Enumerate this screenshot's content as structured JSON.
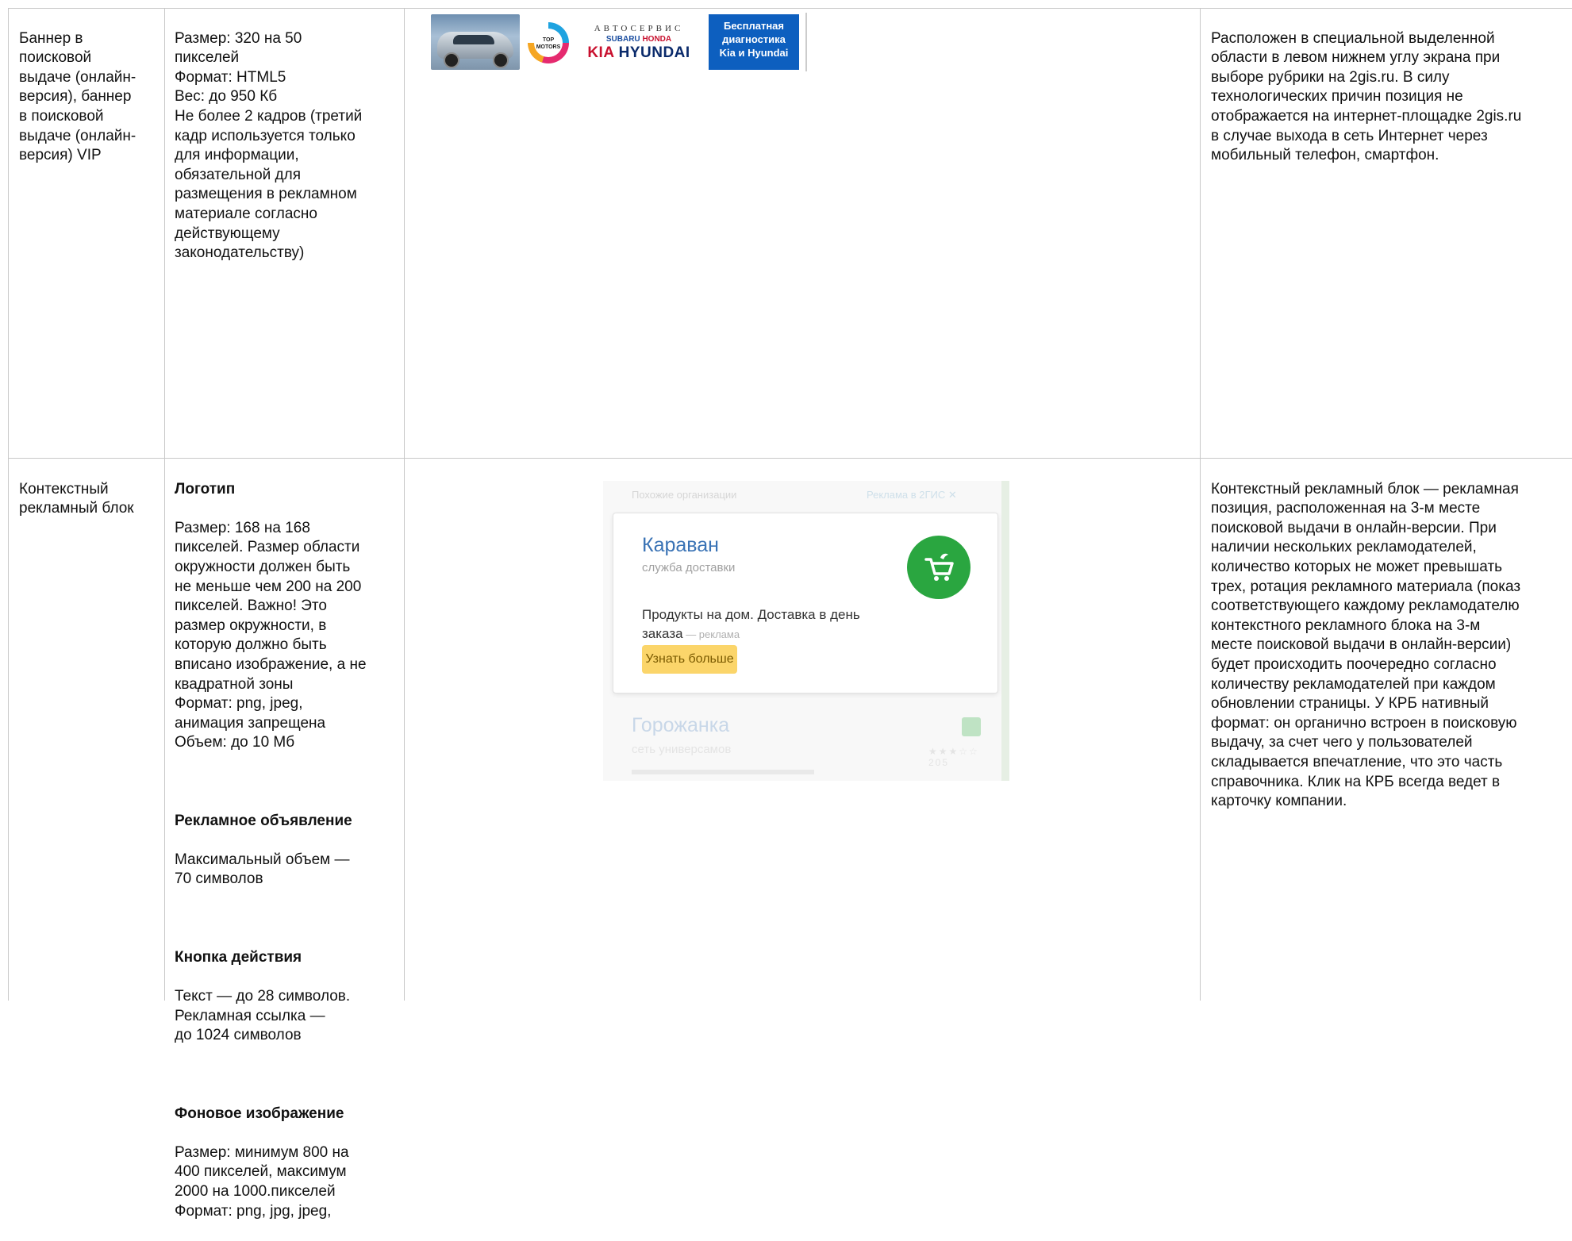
{
  "rows": [
    {
      "name": "Баннер в\nпоисковой\nвыдаче (онлайн-\nверсия), баннер\nв поисковой\nвыдаче (онлайн-\nверсия) VIP",
      "spec": "Размер: 320 на 50\nпикселей\nФормат: HTML5\nВес: до 950 Кб\nНе более 2 кадров (третий\nкадр используется только\nдля информации,\nобязательной для\nразмещения в рекламном\nматериале согласно\nдействующему\nзаконодательству)",
      "description": "Расположен в специальной выделенной\nобласти в левом нижнем углу экрана при\nвыборе рубрики на 2gis.ru. В силу\nтехнологических причин позиция не\nотображается на интернет-площадке 2gis.ru\nв случае выхода в сеть Интернет через\nмобильный телефон, смартфон."
    },
    {
      "name": "Контекстный\nрекламный блок",
      "spec_sections": [
        {
          "title": "Логотип",
          "text": "Размер: 168 на 168\nпикселей. Размер области\nокружности должен быть\nне меньше чем 200 на 200\nпикселей. Важно! Это\nразмер окружности, в\nкоторую должно быть\nвписано изображение, а не\nквадратной зоны\nФормат: png, jpeg,\nанимация запрещена\nОбъем: до 10 Мб"
        },
        {
          "title": "Рекламное объявление",
          "text": "Максимальный объем —\n70 символов"
        },
        {
          "title": "Кнопка действия",
          "text": "Текст — до 28 символов.\nРекламная ссылка —\nдо 1024 символов"
        },
        {
          "title": "Фоновое изображение",
          "text": "Размер: минимум 800 на\n400 пикселей, максимум\n2000 на 1000.пикселей\nФормат: png, jpg, jpeg,"
        }
      ],
      "description": "Контекстный рекламный блок — рекламная\nпозиция, расположенная на 3-м месте\nпоисковой выдачи в онлайн-версии. При\nналичии нескольких рекламодателей,\nколичество которых не может превышать\nтрех, ротация рекламного материала (показ\nсоответствующего каждому рекламодателю\nконтекстного рекламного блока на 3-м\nместе поисковой выдачи в онлайн-версии)\nбудет происходить поочередно согласно\nколичеству рекламодателей при каждом\nобновлении страницы. У КРБ нативный\nформат: он органично встроен в поисковую\nвыдачу, за счет чего у пользователей\nскладывается впечатление, что это часть\nсправочника. Клик на КРБ всегда ведет в\nкарточку компании."
    }
  ],
  "banner": {
    "brand_line1": "АВТОСЕРВИС",
    "brand_line2a": "SUBARU",
    "brand_line2b": "HONDA",
    "brand_line3a": "KIA",
    "brand_line3b": "HYUNDAI",
    "dial_text": "TOP\nMOTORS",
    "promo_text": "Бесплатная\nдиагностика\nKia и Hyundai"
  },
  "ad_card": {
    "header_left": "Похожие организации",
    "header_right": "Реклама в 2ГИС ✕",
    "company": "Караван",
    "category": "служба доставки",
    "ad_text": "Продукты на дом. Доставка в день\nзаказа",
    "ad_label": " — реклама",
    "button": "Узнать больше",
    "next_company": "Горожанка",
    "next_category": "сеть универсамов",
    "next_rating": "★★★☆☆",
    "next_reviews": "205"
  }
}
